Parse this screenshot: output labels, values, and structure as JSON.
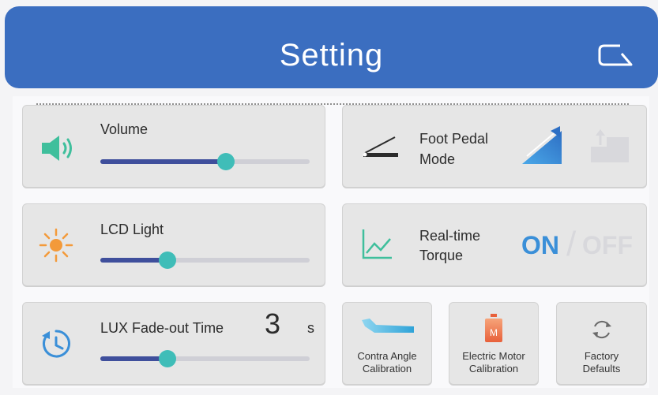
{
  "header": {
    "title": "Setting"
  },
  "volume": {
    "label": "Volume",
    "level": 0.6
  },
  "foot_pedal": {
    "label_line1": "Foot Pedal",
    "label_line2": "Mode"
  },
  "lcd_light": {
    "label": "LCD Light",
    "level": 0.32
  },
  "torque": {
    "label_line1": "Real-time",
    "label_line2": "Torque",
    "on": "ON",
    "sep": "/",
    "off": "OFF"
  },
  "lux": {
    "label": "LUX Fade-out Time",
    "value": "3",
    "unit": "s",
    "level": 0.32
  },
  "contra": {
    "line1": "Contra Angle",
    "line2": "Calibration"
  },
  "motor": {
    "line1": "Electric Motor",
    "line2": "Calibration",
    "icon_letter": "M"
  },
  "factory": {
    "line1": "Factory",
    "line2": "Defaults"
  },
  "colors": {
    "header": "#3b6ec0",
    "accent": "#3fbdb8",
    "slider_fill": "#3f4f9c",
    "on": "#3a8fd8",
    "off": "#d8d8dc"
  }
}
